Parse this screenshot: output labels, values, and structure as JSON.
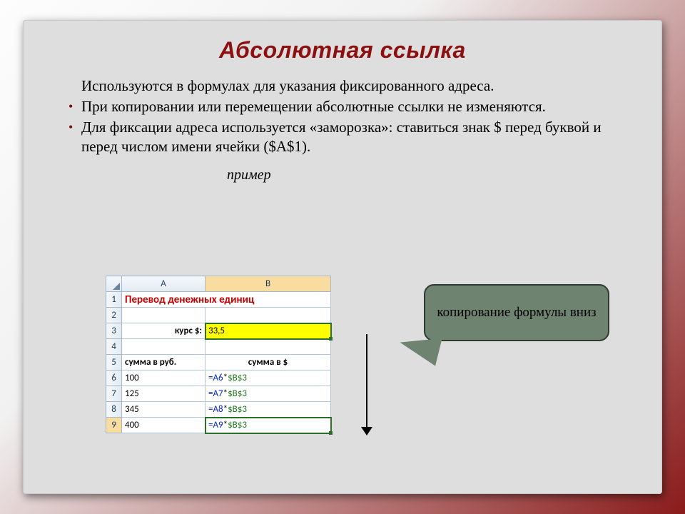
{
  "title": "Абсолютная ссылка",
  "bullets": {
    "b0": "Используются в формулах для указания фиксированного адреса.",
    "b1": "При копировании или перемещении абсолютные ссылки не изменяются.",
    "b2": "Для фиксации адреса используется «заморозка»: ставиться знак $ перед буквой и перед числом имени ячейки ($A$1)."
  },
  "example_label": "пример",
  "callout": "копирование формулы вниз",
  "sheet": {
    "colA": "A",
    "colB": "B",
    "row1": "1",
    "row2": "2",
    "row3": "3",
    "row4": "4",
    "row5": "5",
    "row6": "6",
    "row7": "7",
    "row8": "8",
    "row9": "9",
    "merge_title": "Перевод денежных единиц",
    "rate_label": "курс $:",
    "rate_value": "33,5",
    "header_a": "сумма в руб.",
    "header_b": "сумма в $",
    "r6a": "100",
    "r6b_ref1": "=A6",
    "r6b_ref2": "$B$3",
    "r7a": "125",
    "r7b_ref1": "=A7",
    "r7b_ref2": "$B$3",
    "r8a": "345",
    "r8b_ref1": "=A8",
    "r8b_ref2": "$B$3",
    "r9a": "400",
    "r9b_ref1": "=A9",
    "r9b_ref2": "$B$3",
    "op": "*"
  }
}
